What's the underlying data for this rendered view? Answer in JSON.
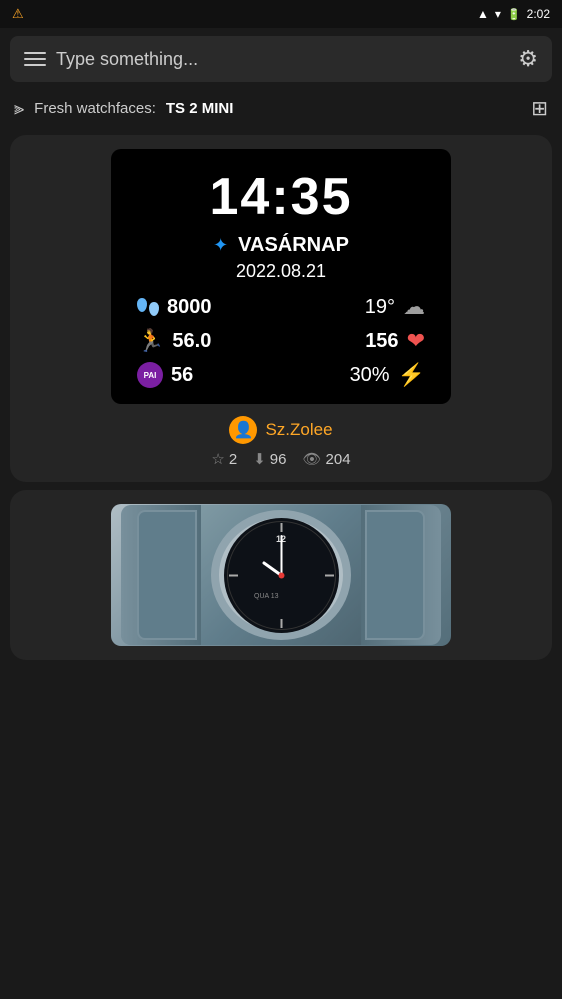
{
  "statusBar": {
    "leftIcon": "warning-icon",
    "signalIcon": "signal-icon",
    "wifiIcon": "wifi-icon",
    "batteryIcon": "battery-icon",
    "time": "2:02"
  },
  "searchBar": {
    "placeholder": "Type something...",
    "gearLabel": "⚙"
  },
  "filterBar": {
    "filterIcon": "⫸",
    "label": "Fresh watchfaces:",
    "value": "TS 2 MINI",
    "gridIcon": "▦"
  },
  "card1": {
    "watchface": {
      "time": "14:35",
      "dayName": "VASÁRNAP",
      "date": "2022.08.21",
      "steps": "8000",
      "temp": "19°",
      "distance": "56.0",
      "heartRate": "156",
      "pai": "56",
      "battery": "30%"
    },
    "creator": {
      "name": "Sz.Zolee",
      "avatarIcon": "👤"
    },
    "stats": {
      "stars": "2",
      "downloads": "96",
      "views": "204"
    }
  }
}
